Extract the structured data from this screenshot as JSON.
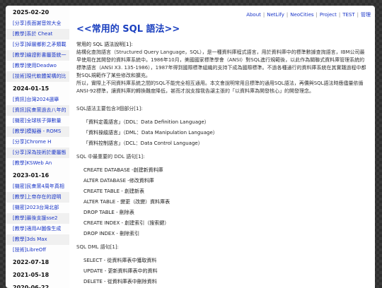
{
  "sidebar": [
    {
      "date": "2025-02-20",
      "items": [
        "[分享]長面謝音效大全",
        "[教學]系於 Cheat",
        "[分享]掉層鄉影之矛類載",
        "[教學]繪證影書屬簽統一",
        "[教學]使用Deadwo",
        "[技術]現代軟體架構的比"
      ]
    },
    {
      "date": "2024-01-15",
      "items": [
        "[資訊]台灣2024選舉",
        "[資訊]民衆黨過去八年的",
        "[機密]全球核子彈數量",
        "[教學]模擬器 - ROMS",
        "[分享]Chrome H",
        "[分享]深為技術於慶屬態",
        "[教學]KSWeb An"
      ]
    },
    {
      "date": "2023-01-16",
      "items": [
        "[機密]民衆黨4周年真相",
        "[教學]上帝存在的證明",
        "[機密]2023台灣北部",
        "[教學]最後支援sse2",
        "[教學]適用AI圖像生成",
        "[教學]3ds Max",
        "[技術]LibreOff"
      ]
    },
    {
      "date": "2022-07-18",
      "items": []
    },
    {
      "date": "2021-05-18",
      "items": []
    },
    {
      "date": "2020-06-22",
      "items": []
    }
  ],
  "topnav": [
    "About",
    "NetLify",
    "NeoCities",
    "Project",
    "TEST",
    "管理"
  ],
  "page": {
    "title": "<<常用的 SQL 語法>>",
    "intro": "常用的 SQL 語法說明[1]:",
    "p1": "結構化查詢語言（Structured Query Language，SQL），是一種資料庫程式語言，用於資料庫中的標準數據查詢語言，IBM公司最早使用在其開發的資料庫系統中。1986年10月，美國國家標準學會（ANSI）對SQL進行規範後，以此作為關聯式資料庫管理系統的標準語言（ANSI X3. 135-1986），1987年得到國際標準組織的支持下成為國際標準。不過各種通行的資料庫系統在其實踐過程中都對SQL規範作了某些修改和擴充。",
    "p2": "所以，實際上不同資料庫系統之間的SQL不能完全相互通用。本文會說明常用且標準的通用SQL語法，再價與SQL語法時應儘量依循ANSI-92標準，讓資料庫的轉換難度降低，甚而才說支撐我告譲主張的「以資料庫為開發核心」的開發理念。",
    "s1": "SQL語法主要包含3個部分[1]:",
    "parts": [
      "「資料定義語言」（DDL：Data Definition Language）",
      "「資料操縱語言」（DML：Data Manipulation Language）",
      "「資料控制語言」（DCL：Data Control Language）"
    ],
    "s2": "SQL 中最重要的 DDL 語句[1]:",
    "ddl": [
      "CREATE DATABASE -創建新資料庫",
      "ALTER DATABASE -修改資料庫",
      "CREATE TABLE - 創建新表",
      "ALTER TABLE - 變更（改變）資料庫表",
      "DROP TABLE - 刪除表",
      "CREATE INDEX - 創建索引（搜索鍵）",
      "DROP INDEX - 刪除索引"
    ],
    "s3": "SQL DML 語句[1]:",
    "dml": [
      "SELECT - 從資料庫表中獲取資料",
      "UPDATE - 更新資料庫表中的資料",
      "DELETE - 從資料庫表中刪除資料"
    ]
  }
}
